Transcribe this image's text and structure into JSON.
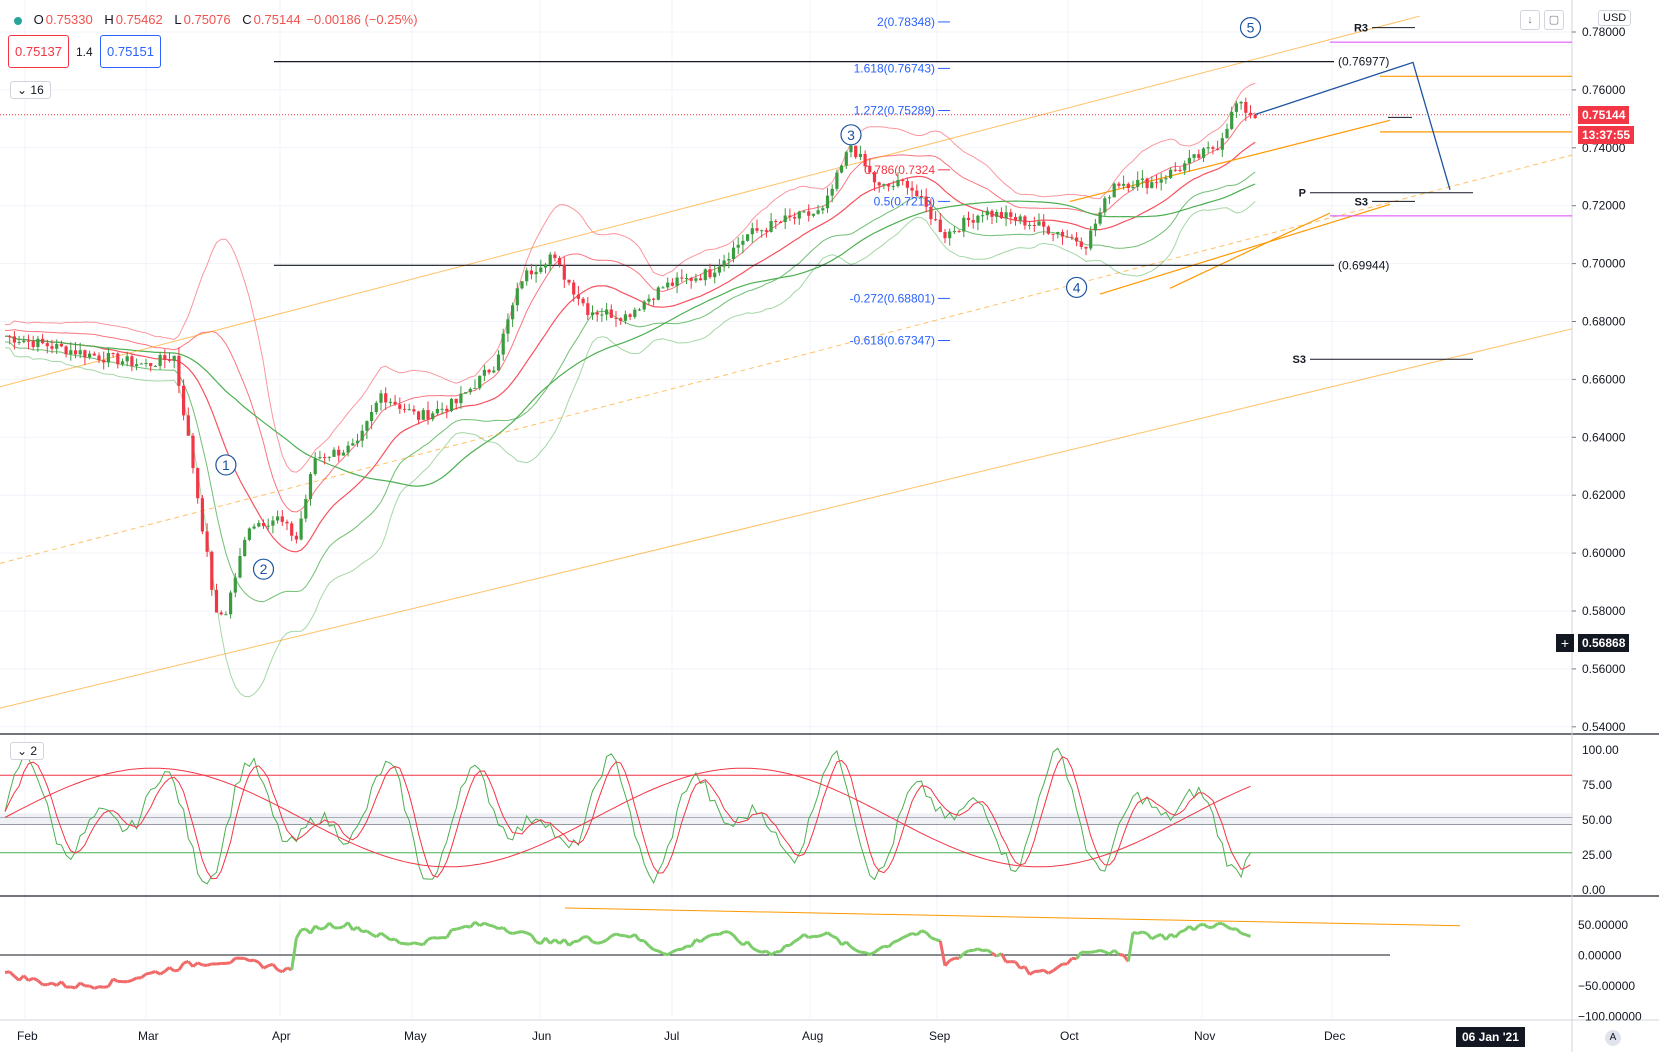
{
  "header": {
    "open_label": "O",
    "open": "0.75330",
    "high_label": "H",
    "high": "0.75462",
    "low_label": "L",
    "low": "0.75076",
    "close_label": "C",
    "close": "0.75144",
    "change": "−0.00186 (−0.25%)",
    "sell_price": "0.75137",
    "spread": "1.4",
    "buy_price": "0.75151",
    "indicator_count_main": "16",
    "indicator_count_sub": "2",
    "currency": "USD",
    "download_icon": "arrow-down-icon",
    "maximize_icon": "square-icon"
  },
  "price_axis": {
    "ticks": [
      "0.78000",
      "0.76000",
      "0.74000",
      "0.72000",
      "0.70000",
      "0.68000",
      "0.66000",
      "0.64000",
      "0.62000",
      "0.60000",
      "0.58000",
      "0.56000",
      "0.54000"
    ],
    "last_price": "0.75144",
    "countdown": "13:37:55",
    "cursor_price": "0.56868",
    "last_price_color": "#f23645"
  },
  "stoch_axis": {
    "ticks": [
      "100.00",
      "75.00",
      "50.00",
      "25.00",
      "0.00"
    ]
  },
  "osc_axis": {
    "ticks": [
      "50.00000",
      "0.00000",
      "−50.00000",
      "−100.00000"
    ]
  },
  "time_axis": {
    "months": [
      "Feb",
      "Mar",
      "Apr",
      "May",
      "Jun",
      "Jul",
      "Aug",
      "Sep",
      "Oct",
      "Nov",
      "Dec"
    ],
    "cursor_date": "06 Jan '21",
    "corner": "A"
  },
  "fib_levels": [
    {
      "label": "2(0.78348)",
      "value": 0.78348,
      "color": "#2962ff"
    },
    {
      "label": "1.618(0.76743)",
      "value": 0.76743,
      "color": "#2962ff"
    },
    {
      "label": "1.272(0.75289)",
      "value": 0.75289,
      "color": "#2962ff"
    },
    {
      "label": "0.786(0.7324",
      "value": 0.7324,
      "color": "#f23645"
    },
    {
      "label": "0.5(0.7215)",
      "value": 0.7215,
      "color": "#2962ff"
    },
    {
      "label": "-0.272(0.68801)",
      "value": 0.68801,
      "color": "#2962ff"
    },
    {
      "label": "-0.618(0.67347)",
      "value": 0.67347,
      "color": "#2962ff"
    }
  ],
  "horizontal_levels": [
    {
      "label": "(0.76977)",
      "value": 0.76977
    },
    {
      "label": "(0.69944)",
      "value": 0.69944
    }
  ],
  "pivot_labels": [
    {
      "label": "R3",
      "value": 0.7815
    },
    {
      "label": "P",
      "value": 0.7245
    },
    {
      "label": "S3",
      "value": 0.7215
    },
    {
      "label": "S3",
      "value": 0.667
    }
  ],
  "wave_labels": [
    {
      "label": "1",
      "date_index": 47,
      "value": 0.6305
    },
    {
      "label": "2",
      "date_index": 55,
      "value": 0.5945
    },
    {
      "label": "3",
      "date_index": 180,
      "value": 0.7445
    },
    {
      "label": "4",
      "date_index": 228,
      "value": 0.6918
    },
    {
      "label": "5",
      "date_index": 265,
      "value": 0.7815
    }
  ],
  "colors": {
    "up_candle": "#26a69a",
    "up_candle_used": "#3a9b3f",
    "down_candle": "#f23645",
    "bb_red": "#f7525f",
    "bb_green": "#4caf50",
    "channel_orange": "#ff9800",
    "fib_blue": "#2962ff"
  }
}
